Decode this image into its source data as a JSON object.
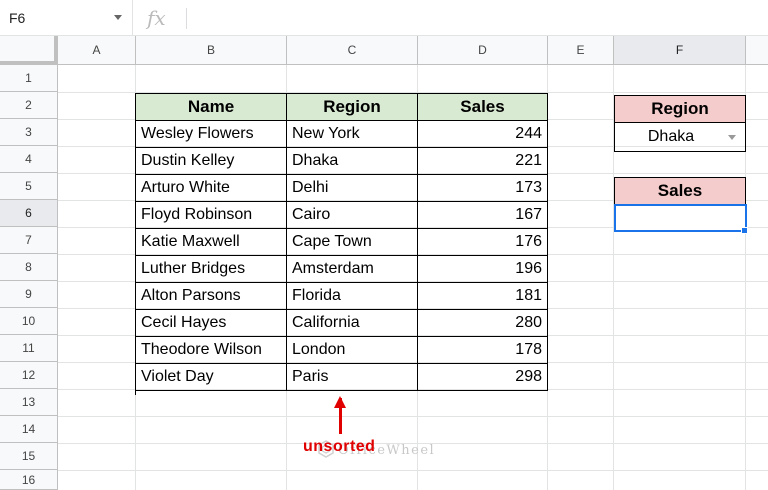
{
  "name_box": {
    "value": "F6"
  },
  "formula_bar": {
    "fx_label": "fx",
    "value": ""
  },
  "columns": [
    "A",
    "B",
    "C",
    "D",
    "E",
    "F"
  ],
  "rows": [
    "1",
    "2",
    "3",
    "4",
    "5",
    "6",
    "7",
    "8",
    "9",
    "10",
    "11",
    "12",
    "13",
    "14",
    "15",
    "16"
  ],
  "selected_column": "F",
  "selected_row": "6",
  "table": {
    "headers": [
      "Name",
      "Region",
      "Sales"
    ],
    "header_color": "#d9ead3",
    "rows": [
      [
        "Wesley Flowers",
        "New York",
        "244"
      ],
      [
        "Dustin Kelley",
        "Dhaka",
        "221"
      ],
      [
        "Arturo White",
        "Delhi",
        "173"
      ],
      [
        "Floyd Robinson",
        "Cairo",
        "167"
      ],
      [
        "Katie Maxwell",
        "Cape Town",
        "176"
      ],
      [
        "Luther Bridges",
        "Amsterdam",
        "196"
      ],
      [
        "Alton Parsons",
        "Florida",
        "181"
      ],
      [
        "Cecil Hayes",
        "California",
        "280"
      ],
      [
        "Theodore Wilson",
        "London",
        "178"
      ],
      [
        "Violet Day",
        "Paris",
        "298"
      ]
    ]
  },
  "lookup": {
    "region_label": "Region",
    "region_value": "Dhaka",
    "sales_label": "Sales",
    "sales_value": "",
    "header_color": "#f4cccc"
  },
  "annotation": {
    "text": "unsorted",
    "color": "#e00000"
  },
  "watermark": {
    "text": "OfficeWheel"
  },
  "colors": {
    "selection": "#1a73e8",
    "header_bg": "#f8f9fa",
    "gridline": "#e2e3e3"
  }
}
